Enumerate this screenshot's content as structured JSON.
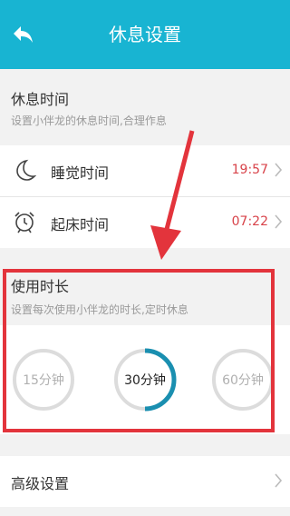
{
  "header": {
    "title": "休息设置",
    "back_icon": "back-arrow-icon"
  },
  "rest_time": {
    "title": "休息时间",
    "desc": "设置小伴龙的休息时间,合理作息",
    "rows": [
      {
        "icon": "moon-icon",
        "label": "睡觉时间",
        "value": "19:57"
      },
      {
        "icon": "alarm-clock-icon",
        "label": "起床时间",
        "value": "07:22"
      }
    ]
  },
  "usage": {
    "title": "使用时长",
    "desc": "设置每次使用小伴龙的时长,定时休息",
    "options": [
      {
        "label": "15分钟",
        "selected": false
      },
      {
        "label": "30分钟",
        "selected": true
      },
      {
        "label": "60分钟",
        "selected": false
      }
    ]
  },
  "advanced": {
    "label": "高级设置"
  },
  "colors": {
    "header": "#18b4d2",
    "accent_ring": "#1a8fb0",
    "time_value": "#d8434a",
    "annotation": "#e3343c"
  }
}
